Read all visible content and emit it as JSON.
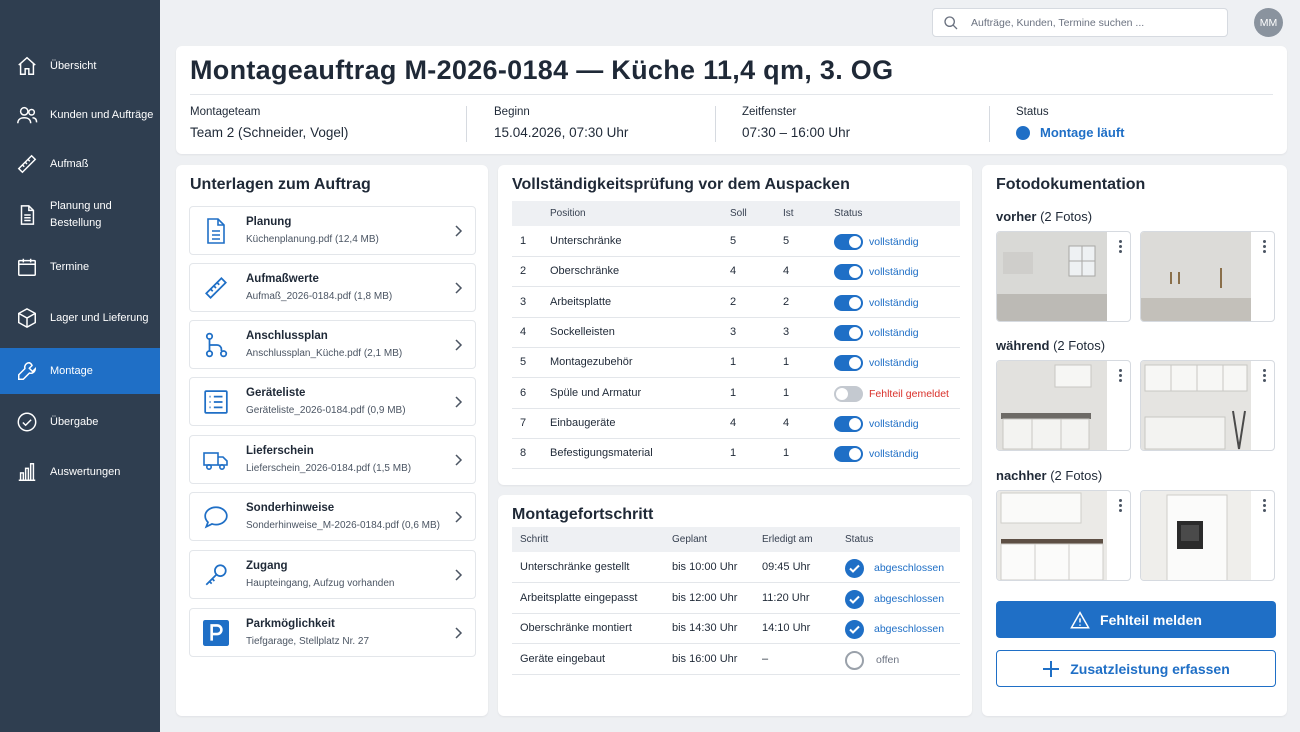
{
  "sidebar": {
    "items": [
      {
        "label": "Übersicht",
        "icon": "home-icon"
      },
      {
        "label": "Kunden und Aufträge",
        "icon": "users-icon"
      },
      {
        "label": "Aufmaß",
        "icon": "ruler-icon"
      },
      {
        "label": "Planung und Bestellung",
        "icon": "document-icon"
      },
      {
        "label": "Termine",
        "icon": "calendar-icon"
      },
      {
        "label": "Lager und Lieferung",
        "icon": "box-icon"
      },
      {
        "label": "Montage",
        "icon": "wrench-icon",
        "active": true
      },
      {
        "label": "Übergabe",
        "icon": "check-circle-icon"
      },
      {
        "label": "Auswertungen",
        "icon": "bar-chart-icon"
      }
    ]
  },
  "topbar": {
    "search_placeholder": "Aufträge, Kunden, Termine suchen ...",
    "avatar_initials": "MM"
  },
  "header": {
    "title": "Montageauftrag M-2026-0184 — Küche 11,4 qm, 3. OG",
    "team_label": "Montageteam",
    "team_value": "Team 2 (Schneider, Vogel)",
    "start_label": "Beginn",
    "start_value": "15.04.2026, 07:30 Uhr",
    "window_label": "Zeitfenster",
    "window_value": "07:30 – 16:00 Uhr",
    "status_label": "Status",
    "status_value": "Montage läuft"
  },
  "documents": {
    "title": "Unterlagen zum Auftrag",
    "items": [
      {
        "name": "Planung",
        "file": "Küchenplanung.pdf (12,4 MB)",
        "icon": "document-icon"
      },
      {
        "name": "Aufmaßwerte",
        "file": "Aufmaß_2026-0184.pdf (1,8 MB)",
        "icon": "ruler-icon"
      },
      {
        "name": "Anschlussplan",
        "file": "Anschlussplan_Küche.pdf (2,1 MB)",
        "icon": "connection-icon"
      },
      {
        "name": "Geräteliste",
        "file": "Geräteliste_2026-0184.pdf (0,9 MB)",
        "icon": "list-icon"
      },
      {
        "name": "Lieferschein",
        "file": "Lieferschein_2026-0184.pdf (1,5 MB)",
        "icon": "truck-icon"
      },
      {
        "name": "Sonderhinweise",
        "file": "Sonderhinweise_M-2026-0184.pdf (0,6 MB)",
        "icon": "chat-icon"
      },
      {
        "name": "Zugang",
        "file": "Haupteingang, Aufzug vorhanden",
        "icon": "key-icon"
      },
      {
        "name": "Parkmöglichkeit",
        "file": "Tiefgarage, Stellplatz Nr. 27",
        "icon": "parking-icon"
      }
    ]
  },
  "check": {
    "title": "Vollständigkeitsprüfung vor dem Auspacken",
    "headers": {
      "position": "Position",
      "soll": "Soll",
      "ist": "Ist",
      "status": "Status"
    },
    "rows": [
      {
        "nr": "1",
        "position": "Unterschränke",
        "soll": "5",
        "ist": "5",
        "status": "vollständig",
        "ok": true
      },
      {
        "nr": "2",
        "position": "Oberschränke",
        "soll": "4",
        "ist": "4",
        "status": "vollständig",
        "ok": true
      },
      {
        "nr": "3",
        "position": "Arbeitsplatte",
        "soll": "2",
        "ist": "2",
        "status": "vollständig",
        "ok": true
      },
      {
        "nr": "4",
        "position": "Sockelleisten",
        "soll": "3",
        "ist": "3",
        "status": "vollständig",
        "ok": true
      },
      {
        "nr": "5",
        "position": "Montagezubehör",
        "soll": "1",
        "ist": "1",
        "status": "vollständig",
        "ok": true
      },
      {
        "nr": "6",
        "position": "Spüle und Armatur",
        "soll": "1",
        "ist": "1",
        "status": "Fehlteil gemeldet",
        "ok": false
      },
      {
        "nr": "7",
        "position": "Einbaugeräte",
        "soll": "4",
        "ist": "4",
        "status": "vollständig",
        "ok": true
      },
      {
        "nr": "8",
        "position": "Befestigungsmaterial",
        "soll": "1",
        "ist": "1",
        "status": "vollständig",
        "ok": true
      }
    ]
  },
  "progress": {
    "title": "Montagefortschritt",
    "headers": {
      "step": "Schritt",
      "planned": "Geplant",
      "done": "Erledigt am",
      "status": "Status"
    },
    "rows": [
      {
        "step": "Unterschränke gestellt",
        "planned": "bis 10:00 Uhr",
        "done": "09:45 Uhr",
        "status": "abgeschlossen",
        "complete": true
      },
      {
        "step": "Arbeitsplatte eingepasst",
        "planned": "bis 12:00 Uhr",
        "done": "11:20 Uhr",
        "status": "abgeschlossen",
        "complete": true
      },
      {
        "step": "Oberschränke montiert",
        "planned": "bis 14:30 Uhr",
        "done": "14:10 Uhr",
        "status": "abgeschlossen",
        "complete": true
      },
      {
        "step": "Geräte eingebaut",
        "planned": "bis 16:00 Uhr",
        "done": "–",
        "status": "offen",
        "complete": false
      }
    ]
  },
  "photos": {
    "title": "Fotodokumentation",
    "phases": [
      {
        "name": "vorher",
        "count": "(2 Fotos)"
      },
      {
        "name": "während",
        "count": "(2 Fotos)"
      },
      {
        "name": "nachher",
        "count": "(2 Fotos)"
      }
    ],
    "report_button": "Fehlteil melden",
    "extra_button": "Zusatzleistung erfassen"
  },
  "colors": {
    "sidebar": "#2f3e50",
    "accent": "#1f6fc6",
    "error": "#d9312b"
  }
}
